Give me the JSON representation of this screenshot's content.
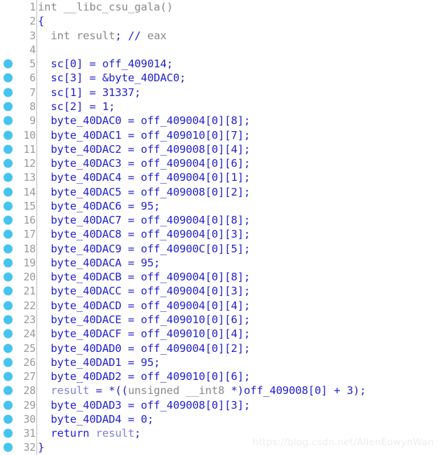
{
  "editor": {
    "name": "decompiler-pseudocode",
    "language": "c",
    "total_lines": 32,
    "colors": {
      "background": "#ffffff",
      "code": "#2222cc",
      "comment": "#8a8a8a",
      "type_keyword": "#808080",
      "local_variable": "#8080d0",
      "line_number": "#9a9a9a",
      "breakpoint_dot": "#45c4f0",
      "gutter_separator": "#bfbfbf",
      "watermark": "#ededed"
    }
  },
  "watermark": {
    "text": "https://blog.csdn.net/AlienEowynWan"
  },
  "lines": [
    {
      "number": "1",
      "dot": false,
      "tokens": [
        {
          "t": "int ",
          "c": "gray"
        },
        {
          "t": "__libc_csu_gala()",
          "c": "gray"
        }
      ]
    },
    {
      "number": "2",
      "dot": false,
      "tokens": [
        {
          "t": "{",
          "c": "blue"
        }
      ]
    },
    {
      "number": "3",
      "dot": false,
      "tokens": [
        {
          "t": "  ",
          "c": "blue"
        },
        {
          "t": "int",
          "c": "gray"
        },
        {
          "t": " ",
          "c": "blue"
        },
        {
          "t": "result",
          "c": "gray"
        },
        {
          "t": ";",
          "c": "blue"
        },
        {
          "t": " ",
          "c": "blue"
        },
        {
          "t": "//",
          "c": "blue"
        },
        {
          "t": " eax",
          "c": "gray"
        }
      ]
    },
    {
      "number": "4",
      "dot": false,
      "tokens": []
    },
    {
      "number": "5",
      "dot": true,
      "tokens": [
        {
          "t": "  sc[0] = off_409014;",
          "c": "blue"
        }
      ]
    },
    {
      "number": "6",
      "dot": true,
      "tokens": [
        {
          "t": "  sc[3] = &byte_40DAC0;",
          "c": "blue"
        }
      ]
    },
    {
      "number": "7",
      "dot": true,
      "tokens": [
        {
          "t": "  sc[1] = 31337;",
          "c": "blue"
        }
      ]
    },
    {
      "number": "8",
      "dot": true,
      "tokens": [
        {
          "t": "  sc[2] = 1;",
          "c": "blue"
        }
      ]
    },
    {
      "number": "9",
      "dot": true,
      "tokens": [
        {
          "t": "  byte_40DAC0 = off_409004[0][8];",
          "c": "blue"
        }
      ]
    },
    {
      "number": "10",
      "dot": true,
      "tokens": [
        {
          "t": "  byte_40DAC1 = off_409010[0][7];",
          "c": "blue"
        }
      ]
    },
    {
      "number": "11",
      "dot": true,
      "tokens": [
        {
          "t": "  byte_40DAC2 = off_409008[0][4];",
          "c": "blue"
        }
      ]
    },
    {
      "number": "12",
      "dot": true,
      "tokens": [
        {
          "t": "  byte_40DAC3 = off_409004[0][6];",
          "c": "blue"
        }
      ]
    },
    {
      "number": "13",
      "dot": true,
      "tokens": [
        {
          "t": "  byte_40DAC4 = off_409004[0][1];",
          "c": "blue"
        }
      ]
    },
    {
      "number": "14",
      "dot": true,
      "tokens": [
        {
          "t": "  byte_40DAC5 = off_409008[0][2];",
          "c": "blue"
        }
      ]
    },
    {
      "number": "15",
      "dot": true,
      "tokens": [
        {
          "t": "  byte_40DAC6 = 95;",
          "c": "blue"
        }
      ]
    },
    {
      "number": "16",
      "dot": true,
      "tokens": [
        {
          "t": "  byte_40DAC7 = off_409004[0][8];",
          "c": "blue"
        }
      ]
    },
    {
      "number": "17",
      "dot": true,
      "tokens": [
        {
          "t": "  byte_40DAC8 = off_409004[0][3];",
          "c": "blue"
        }
      ]
    },
    {
      "number": "18",
      "dot": true,
      "tokens": [
        {
          "t": "  byte_40DAC9 = off_40900C[0][5];",
          "c": "blue"
        }
      ]
    },
    {
      "number": "19",
      "dot": true,
      "tokens": [
        {
          "t": "  byte_40DACA = 95;",
          "c": "blue"
        }
      ]
    },
    {
      "number": "20",
      "dot": true,
      "tokens": [
        {
          "t": "  byte_40DACB = off_409004[0][8];",
          "c": "blue"
        }
      ]
    },
    {
      "number": "21",
      "dot": true,
      "tokens": [
        {
          "t": "  byte_40DACC = off_409004[0][3];",
          "c": "blue"
        }
      ]
    },
    {
      "number": "22",
      "dot": true,
      "tokens": [
        {
          "t": "  byte_40DACD = off_409004[0][4];",
          "c": "blue"
        }
      ]
    },
    {
      "number": "23",
      "dot": true,
      "tokens": [
        {
          "t": "  byte_40DACE = off_409010[0][6];",
          "c": "blue"
        }
      ]
    },
    {
      "number": "24",
      "dot": true,
      "tokens": [
        {
          "t": "  byte_40DACF = off_409010[0][4];",
          "c": "blue"
        }
      ]
    },
    {
      "number": "25",
      "dot": true,
      "tokens": [
        {
          "t": "  byte_40DAD0 = off_409004[0][2];",
          "c": "blue"
        }
      ]
    },
    {
      "number": "26",
      "dot": true,
      "tokens": [
        {
          "t": "  byte_40DAD1 = 95;",
          "c": "blue"
        }
      ]
    },
    {
      "number": "27",
      "dot": true,
      "tokens": [
        {
          "t": "  byte_40DAD2 = off_409010[0][6];",
          "c": "blue"
        }
      ]
    },
    {
      "number": "28",
      "dot": true,
      "tokens": [
        {
          "t": "  ",
          "c": "blue"
        },
        {
          "t": "result",
          "c": "local"
        },
        {
          "t": " = *((",
          "c": "blue"
        },
        {
          "t": "unsigned __int8",
          "c": "gray"
        },
        {
          "t": " *)off_409008[0] + 3);",
          "c": "blue"
        }
      ]
    },
    {
      "number": "29",
      "dot": true,
      "tokens": [
        {
          "t": "  byte_40DAD3 = off_409008[0][3];",
          "c": "blue"
        }
      ]
    },
    {
      "number": "30",
      "dot": true,
      "tokens": [
        {
          "t": "  byte_40DAD4 = 0;",
          "c": "blue"
        }
      ]
    },
    {
      "number": "31",
      "dot": true,
      "tokens": [
        {
          "t": "  ",
          "c": "blue"
        },
        {
          "t": "return",
          "c": "blue"
        },
        {
          "t": " ",
          "c": "blue"
        },
        {
          "t": "result",
          "c": "local"
        },
        {
          "t": ";",
          "c": "blue"
        }
      ]
    },
    {
      "number": "32",
      "dot": true,
      "tokens": [
        {
          "t": "}",
          "c": "blue"
        }
      ]
    }
  ]
}
